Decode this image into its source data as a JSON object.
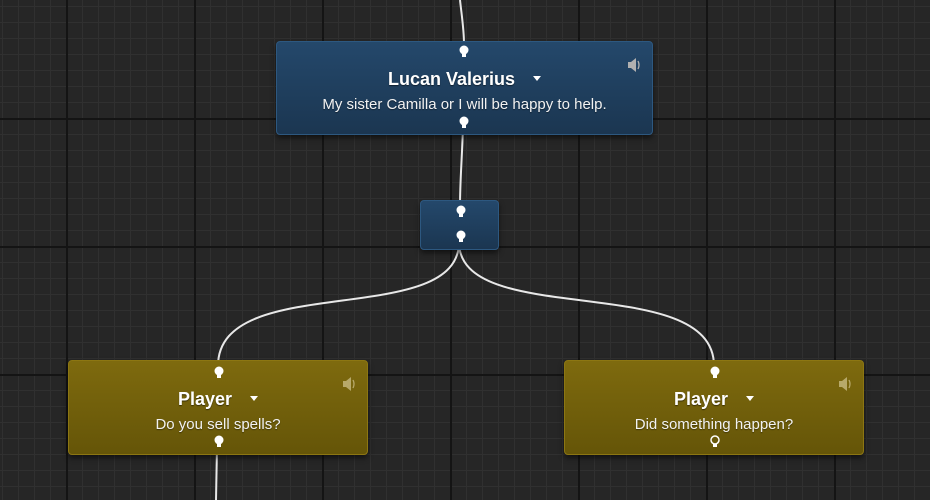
{
  "graph": {
    "nodes": [
      {
        "id": "npc-lucan",
        "kind": "npc",
        "speaker": "Lucan Valerius",
        "text": "My sister Camilla or I will be happy to help.",
        "has_audio": true
      },
      {
        "id": "player-spells",
        "kind": "player",
        "speaker": "Player",
        "text": "Do you sell spells?",
        "has_audio": true
      },
      {
        "id": "player-happen",
        "kind": "player",
        "speaker": "Player",
        "text": "Did something happen?",
        "has_audio": true
      }
    ]
  },
  "icons": {
    "speaker": "speaker-icon",
    "pin_connected": "connected-pin-icon",
    "pin_empty": "empty-output-pin-icon",
    "dropdown": "chevron-down-icon"
  },
  "colors": {
    "npc_node": "#1e3c5a",
    "player_node": "#725f0b",
    "wire": "#e8e8e8",
    "grid_bg": "#262626"
  }
}
